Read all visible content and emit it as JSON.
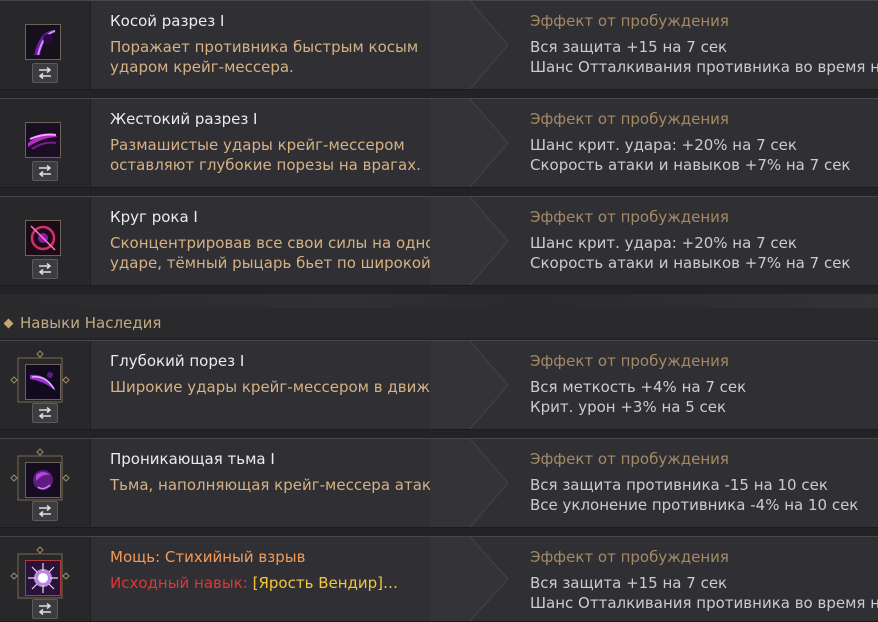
{
  "skills": [
    {
      "name": "Косой разрез I",
      "desc": [
        "Поражает противника быстрым косым",
        "ударом крейг-мессера."
      ],
      "effect_title": "Эффект от пробуждения",
      "effects": [
        "Вся защита +15 на 7 сек",
        "Шанс Отталкивания противника во время н…"
      ],
      "icon": "slash-icon",
      "accent": "#9b2fd1"
    },
    {
      "name": "Жестокий разрез I",
      "desc": [
        "Размашистые удары крейг-мессером",
        "оставляют глубокие порезы на врагах."
      ],
      "effect_title": "Эффект от пробуждения",
      "effects": [
        "Шанс крит. удара: +20% на 7 сек",
        "Скорость атаки и навыков +7% на 7 сек"
      ],
      "icon": "cut-icon",
      "accent": "#c02fd0"
    },
    {
      "name": "Круг рока I",
      "desc": [
        "Сконцентрировав все свои силы на одном",
        "ударе, тёмный рыцарь бьет по широкой дуг…"
      ],
      "effect_title": "Эффект от пробуждения",
      "effects": [
        "Шанс крит. удара: +20% на 7 сек",
        "Скорость атаки и навыков +7% на 7 сек"
      ],
      "icon": "circle-icon",
      "accent": "#d12f6e"
    }
  ],
  "legacy_section": {
    "title": "Навыки Наследия"
  },
  "legacy_skills": [
    {
      "name": "Глубокий порез I",
      "desc": [
        "Широкие удары крейг-мессером в движени…"
      ],
      "effect_title": "Эффект от пробуждения",
      "effects": [
        "Вся меткость +4% на 7 сек",
        "Крит. урон +3% на 5 сек"
      ],
      "icon": "deep-cut-icon",
      "accent": "#9d2fd8"
    },
    {
      "name": "Проникающая тьма I",
      "desc": [
        "Тьма, наполняющая крейг-мессера атакует …"
      ],
      "effect_title": "Эффект от пробуждения",
      "effects": [
        "Вся защита противника -15 на 10 сек",
        "Все уклонение противника -4% на 10 сек"
      ],
      "icon": "darkness-icon",
      "accent": "#8e2fb8"
    },
    {
      "name": "Мощь: Стихийный взрыв",
      "desc_red": "Исходный навык:",
      "desc_yellow": "[Ярость Вендир]…",
      "effect_title": "Эффект от пробуждения",
      "effects": [
        "Вся защита +15 на 7 сек",
        "Шанс Отталкивания противника во время н…"
      ],
      "icon": "burst-icon",
      "accent": "#d7c3f0"
    }
  ],
  "colors": {
    "title": "#ececec",
    "title_special": "#f39a55",
    "desc": "#d5b184",
    "effect_title": "#a48a64",
    "effect_text": "#c9ccd2"
  }
}
